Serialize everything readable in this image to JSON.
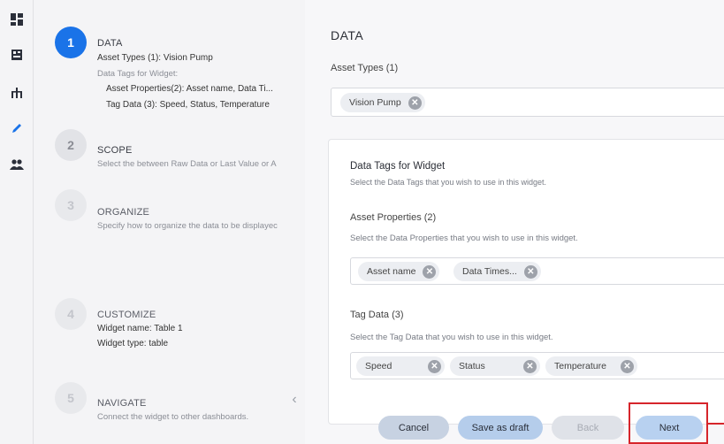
{
  "rail": {
    "icons": [
      "dashboard-icon",
      "book-icon",
      "hierarchy-icon",
      "pencil-icon",
      "users-icon"
    ]
  },
  "steps": [
    {
      "number": "1",
      "title": "DATA",
      "lines": [
        "Asset Types (1): Vision Pump",
        "Data Tags for Widget:",
        "Asset Properties(2): Asset name, Data Ti...",
        "Tag Data (3): Speed, Status, Temperature"
      ]
    },
    {
      "number": "2",
      "title": "SCOPE",
      "lines": [
        "Select the between Raw Data or Last Value or A"
      ]
    },
    {
      "number": "3",
      "title": "ORGANIZE",
      "lines": [
        "Specify how to organize the data to be displayec"
      ]
    },
    {
      "number": "4",
      "title": "CUSTOMIZE",
      "lines": [
        "Widget name: Table 1",
        "Widget type: table"
      ]
    },
    {
      "number": "5",
      "title": "NAVIGATE",
      "lines": [
        "Connect the widget to other dashboards."
      ]
    }
  ],
  "collapse_glyph": "‹",
  "main": {
    "title": "DATA",
    "asset_types_label": "Asset Types (1)",
    "asset_chips": [
      "Vision Pump"
    ],
    "card": {
      "title": "Data Tags for Widget",
      "subtitle": "Select the Data Tags that you wish to use in this widget.",
      "asset_properties_label": "Asset Properties (2)",
      "asset_properties_sub": "Select the Data Properties that you wish to use in this widget.",
      "asset_properties_chips": [
        "Asset name",
        "Data Times..."
      ],
      "tag_data_label": "Tag Data (3)",
      "tag_data_sub": "Select the Tag Data that you wish to use in this widget.",
      "tag_data_chips": [
        "Speed",
        "Status",
        "Temperature"
      ]
    }
  },
  "chip_remove_glyph": "✕",
  "buttons": {
    "cancel": "Cancel",
    "save_draft": "Save as draft",
    "back": "Back",
    "next": "Next"
  },
  "colors": {
    "accent": "#1a73e8",
    "highlight": "#d6252b"
  }
}
